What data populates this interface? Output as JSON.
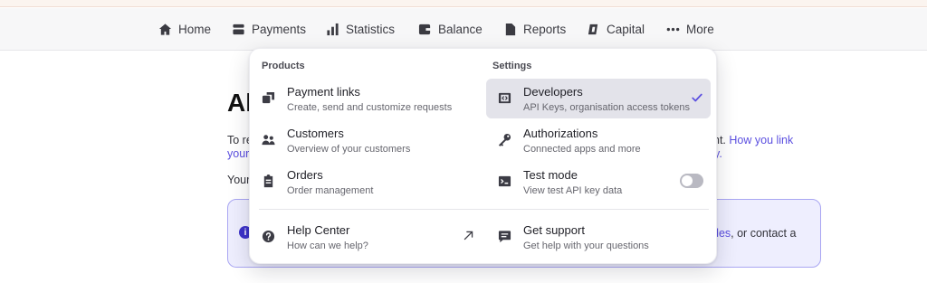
{
  "nav": {
    "items": [
      {
        "label": "Home",
        "icon": "home-icon"
      },
      {
        "label": "Payments",
        "icon": "payments-icon"
      },
      {
        "label": "Statistics",
        "icon": "statistics-icon"
      },
      {
        "label": "Balance",
        "icon": "balance-icon"
      },
      {
        "label": "Reports",
        "icon": "reports-icon"
      },
      {
        "label": "Capital",
        "icon": "capital-icon"
      },
      {
        "label": "More",
        "icon": "more-dots-icon"
      }
    ]
  },
  "background": {
    "title": "Al",
    "line1_start": "To re",
    "line1_end": "nt.",
    "line1_link": "How you link",
    "line2_start": "your",
    "line2_end": "y.",
    "line3_start": "Your",
    "info_box_link": "des",
    "info_box_text": ", or contact a"
  },
  "dropdown": {
    "products": {
      "title": "Products",
      "items": [
        {
          "title": "Payment links",
          "subtitle": "Create, send and customize requests",
          "icon": "payment-links-icon"
        },
        {
          "title": "Customers",
          "subtitle": "Overview of your customers",
          "icon": "customers-icon"
        },
        {
          "title": "Orders",
          "subtitle": "Order management",
          "icon": "orders-icon"
        }
      ]
    },
    "settings": {
      "title": "Settings",
      "items": [
        {
          "title": "Developers",
          "subtitle": "API Keys, organisation access tokens",
          "icon": "developers-icon",
          "selected": true
        },
        {
          "title": "Authorizations",
          "subtitle": "Connected apps and more",
          "icon": "key-icon"
        },
        {
          "title": "Test mode",
          "subtitle": "View test API key data",
          "icon": "terminal-icon",
          "toggle_on": false
        }
      ]
    },
    "footer": {
      "help": {
        "title": "Help Center",
        "subtitle": "How can we help?",
        "icon": "help-icon"
      },
      "support": {
        "title": "Get support",
        "subtitle": "Get help with your questions",
        "icon": "chat-icon"
      }
    }
  },
  "colors": {
    "accent": "#5b4fe0",
    "selected_bg": "#e3e3ea",
    "info_box_bg": "#eeeefe"
  }
}
